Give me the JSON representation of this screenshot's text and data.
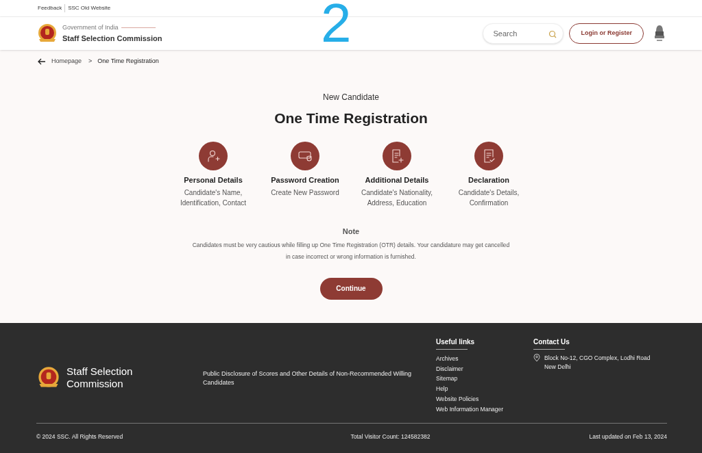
{
  "top_links": [
    "Feedback",
    "SSC Old Website"
  ],
  "header": {
    "org_line": "Government of India",
    "org_name": "Staff Selection Commission",
    "search": {
      "placeholder": "Search"
    },
    "login_button": "Login or Register"
  },
  "overlay_label": "2",
  "breadcrumb": [
    "Homepage",
    ">",
    "One Time Registration"
  ],
  "subtitle": "New Candidate",
  "title": "One Time Registration",
  "steps": [
    {
      "kind": "person",
      "title": "Personal Details",
      "description": "Candidate's Name, Identification, Contact"
    },
    {
      "kind": "password",
      "title": "Password Creation",
      "description": "Create New Password"
    },
    {
      "kind": "document-add",
      "title": "Additional Details",
      "description": "Candidate's Nationality, Address, Education"
    },
    {
      "kind": "document-check",
      "title": "Declaration",
      "description": "Candidate's Details, Confirmation"
    }
  ],
  "note": {
    "title": "Note",
    "text": "Candidates must be very cautious while filling up One Time Registration (OTR) details. Your candidature may get cancelled in case incorrect or wrong information is furnished."
  },
  "continue_button": "Continue",
  "footer": {
    "org_name": "Staff Selection Commission",
    "disclosure_link": "Public Disclosure of Scores and Other Details of Non-Recommended Willing Candidates",
    "useful_links": {
      "heading": "Useful links",
      "items": [
        "Archives",
        "Disclaimer",
        "Sitemap",
        "Help",
        "Website Policies",
        "Web Information Manager"
      ]
    },
    "contact": {
      "heading": "Contact Us",
      "address": [
        "Block No-12, CGO Complex, Lodhi Road",
        "New Delhi"
      ]
    },
    "copyright": "© 2024 SSC. All Rights Reserved",
    "visitor_count": "Total Visitor Count: 124582382",
    "last_updated": "Last updated on Feb 13, 2024"
  }
}
